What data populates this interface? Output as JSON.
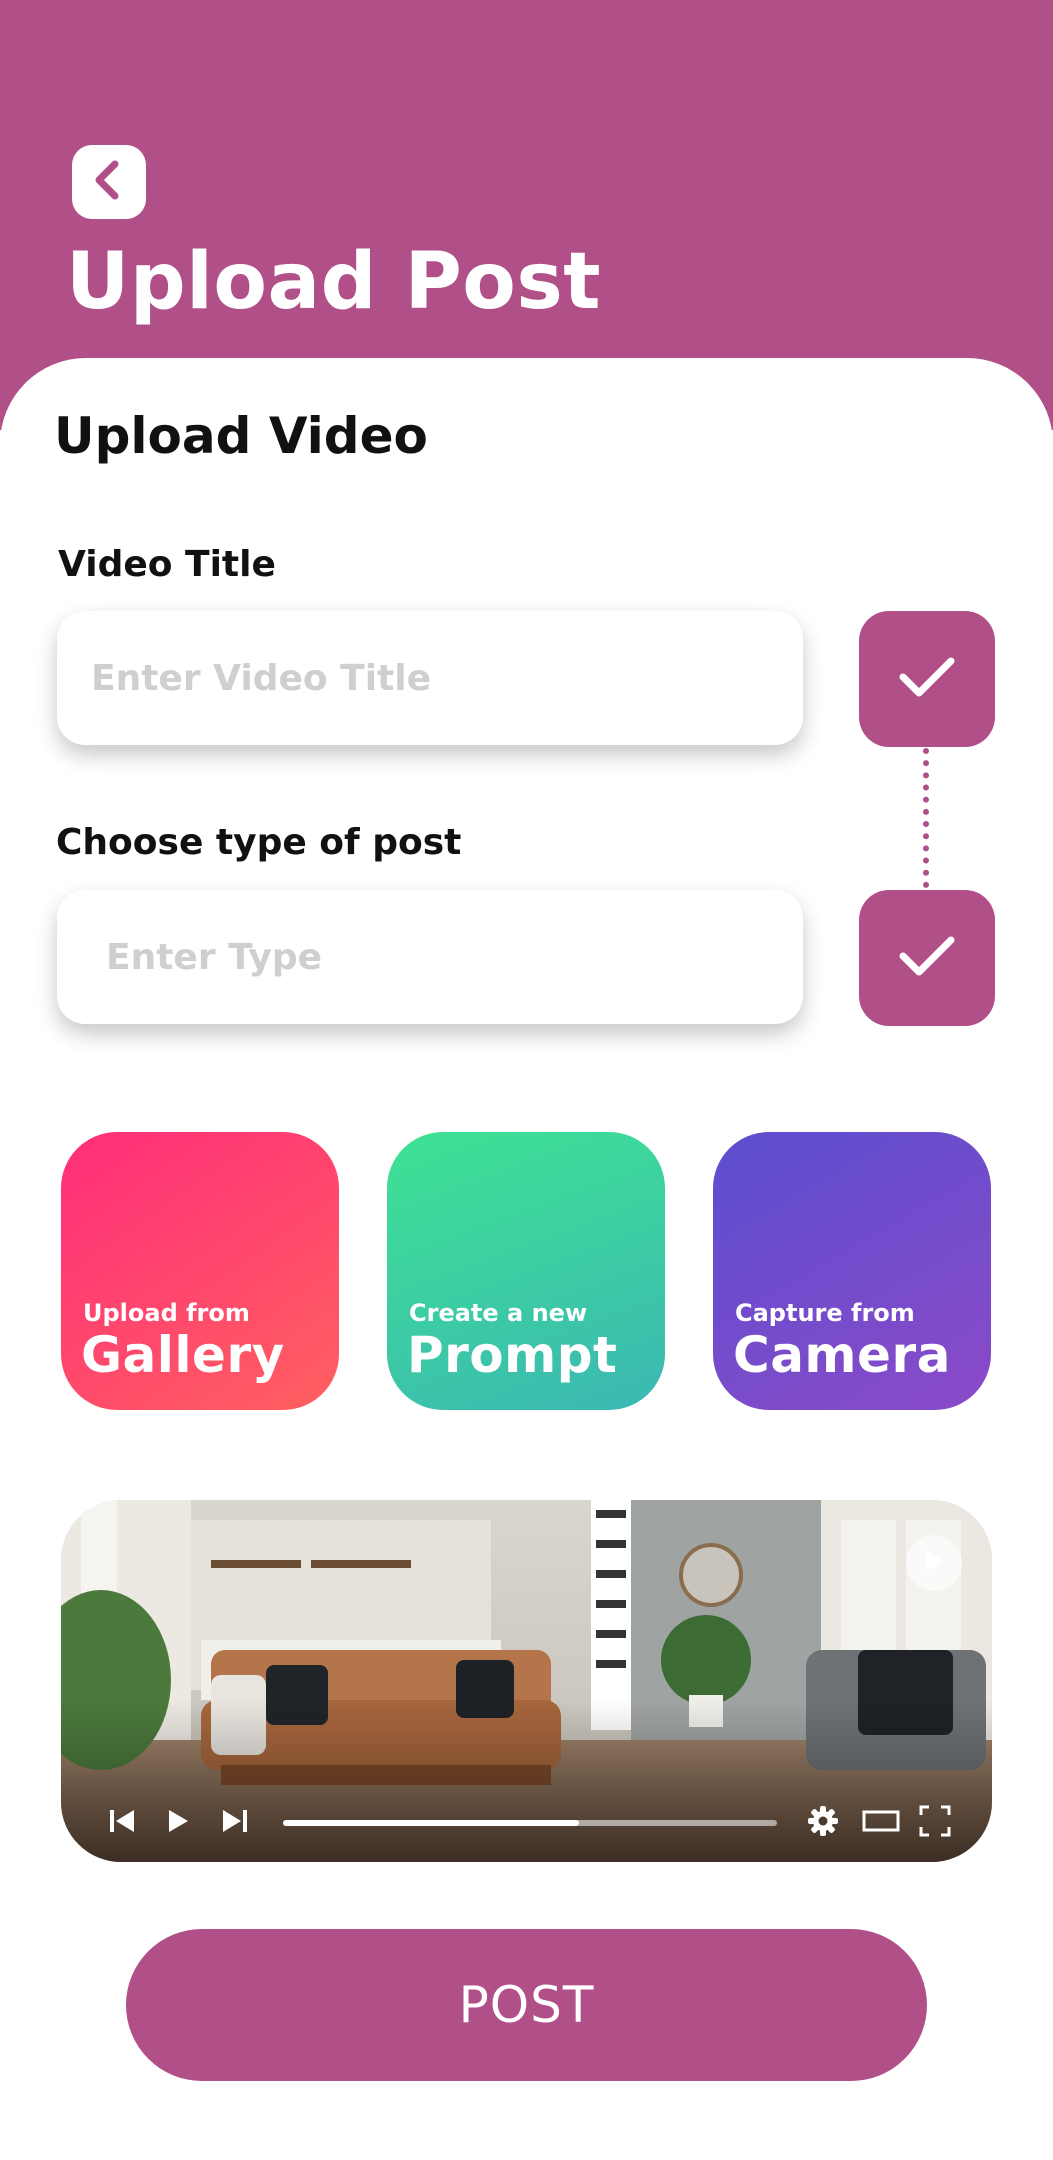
{
  "header": {
    "title": "Upload Post",
    "back_icon": "chevron-left-icon",
    "background_color": "#b14f89"
  },
  "form": {
    "section_title": "Upload Video",
    "video_title": {
      "label": "Video Title",
      "value": "",
      "placeholder": "Enter Video Title",
      "check_icon": "check-icon"
    },
    "post_type": {
      "label": "Choose type of post",
      "value": "",
      "placeholder": "Enter Type",
      "check_icon": "check-icon"
    }
  },
  "sources": [
    {
      "small": "Upload from",
      "big": "Gallery",
      "colors": [
        "#ff2d7a",
        "#ff6060"
      ]
    },
    {
      "small": "Create a new",
      "big": "Prompt",
      "colors": [
        "#3ee293",
        "#3bb8b3"
      ]
    },
    {
      "small": "Capture from",
      "big": "Camera",
      "colors": [
        "#5b4ecf",
        "#8b4ac8"
      ]
    }
  ],
  "video_player": {
    "progress": 0.6,
    "icons": [
      "skip-back-icon",
      "play-icon",
      "skip-forward-icon",
      "gear-icon",
      "theater-mode-icon",
      "fullscreen-icon",
      "play-overlay-icon"
    ]
  },
  "post_button": {
    "label": "POST"
  },
  "accent_color": "#b14f89"
}
